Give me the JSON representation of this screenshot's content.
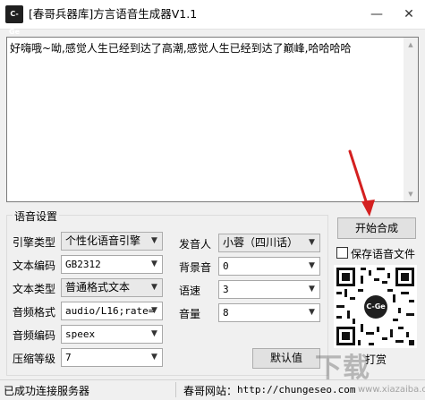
{
  "window": {
    "app_icon_text": "C-Ge",
    "title": "[春哥兵器库]方言语音生成器V1.1",
    "minimize_glyph": "—",
    "close_glyph": "✕"
  },
  "input": {
    "text": "好嗨哦~呦,感觉人生已经到达了高潮,感觉人生已经到达了巅峰,哈哈哈哈"
  },
  "settings": {
    "group_title": "语音设置",
    "engine_type": {
      "label": "引擎类型",
      "value": "个性化语音引擎"
    },
    "text_encoding": {
      "label": "文本编码",
      "value": "GB2312"
    },
    "text_type": {
      "label": "文本类型",
      "value": "普通格式文本"
    },
    "audio_format": {
      "label": "音频格式",
      "value": "audio/L16;rate="
    },
    "audio_encoding": {
      "label": "音频编码",
      "value": "speex"
    },
    "compression_level": {
      "label": "压缩等级",
      "value": "7"
    },
    "speaker": {
      "label": "发音人",
      "value": "小蓉（四川话）"
    },
    "background_sound": {
      "label": "背景音",
      "value": "0"
    },
    "speed": {
      "label": "语速",
      "value": "3"
    },
    "volume": {
      "label": "音量",
      "value": "8"
    },
    "default_button": "默认值"
  },
  "actions": {
    "start_button": "开始合成",
    "save_checkbox_label": "保存语音文件",
    "save_checked": false,
    "tip_label": "打赏",
    "qr_logo_text": "C-Ge"
  },
  "status": {
    "connection": "已成功连接服务器",
    "website_label": "春哥网站：",
    "website_url": "http://chungeseo.com"
  },
  "watermark": {
    "text": "下载",
    "url": "www.xiazaiba.com"
  },
  "colors": {
    "arrow": "#d42020",
    "qr": "#111111"
  }
}
